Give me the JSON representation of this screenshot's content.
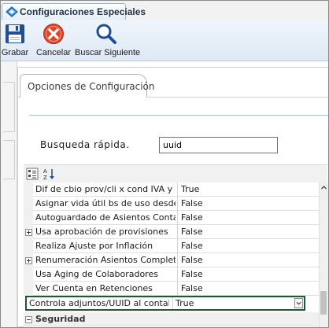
{
  "window": {
    "tab_title": "Configuraciones Especiales"
  },
  "toolbar": {
    "save_label": "Grabar",
    "cancel_label": "Cancelar",
    "find_next_label": "Buscar Siguiente"
  },
  "panel": {
    "tab_label": "Opciones de Configuración"
  },
  "search": {
    "label": "Busqueda rápida.",
    "value": "uuid"
  },
  "grid": {
    "rows": [
      {
        "name": "Dif de cbio prov/cli x cond IVA y grupo e",
        "value": "True",
        "expandable": false
      },
      {
        "name": "Asignar vida útil bs de uso desde solic. c",
        "value": "False",
        "expandable": false
      },
      {
        "name": "Autoguardado de Asientos Contables",
        "value": "False",
        "expandable": false
      },
      {
        "name": "Usa aprobación de provisiones",
        "value": "False",
        "expandable": true
      },
      {
        "name": "Realiza Ajuste por Inflación",
        "value": "False",
        "expandable": false
      },
      {
        "name": "Renumeración Asientos Completa",
        "value": "False",
        "expandable": true
      },
      {
        "name": "Usa Aging de Colaboradores",
        "value": "False",
        "expandable": false
      },
      {
        "name": "Ver Cuenta en Retenciones",
        "value": "False",
        "expandable": false
      }
    ],
    "selected_row": {
      "name": "Controla adjuntos/UUID al contabilizar",
      "value": "True"
    },
    "category": {
      "name": "Seguridad"
    }
  },
  "colors": {
    "selection_border": "#1f5a2e",
    "cancel_red": "#e0452c",
    "icon_blue": "#1f4e96"
  },
  "icons": {
    "app": "app-logo-icon",
    "save": "floppy-disk-icon",
    "cancel": "cancel-x-icon",
    "find": "magnifier-icon",
    "categorized": "categorized-view-icon",
    "alphabetical": "sort-az-icon"
  }
}
